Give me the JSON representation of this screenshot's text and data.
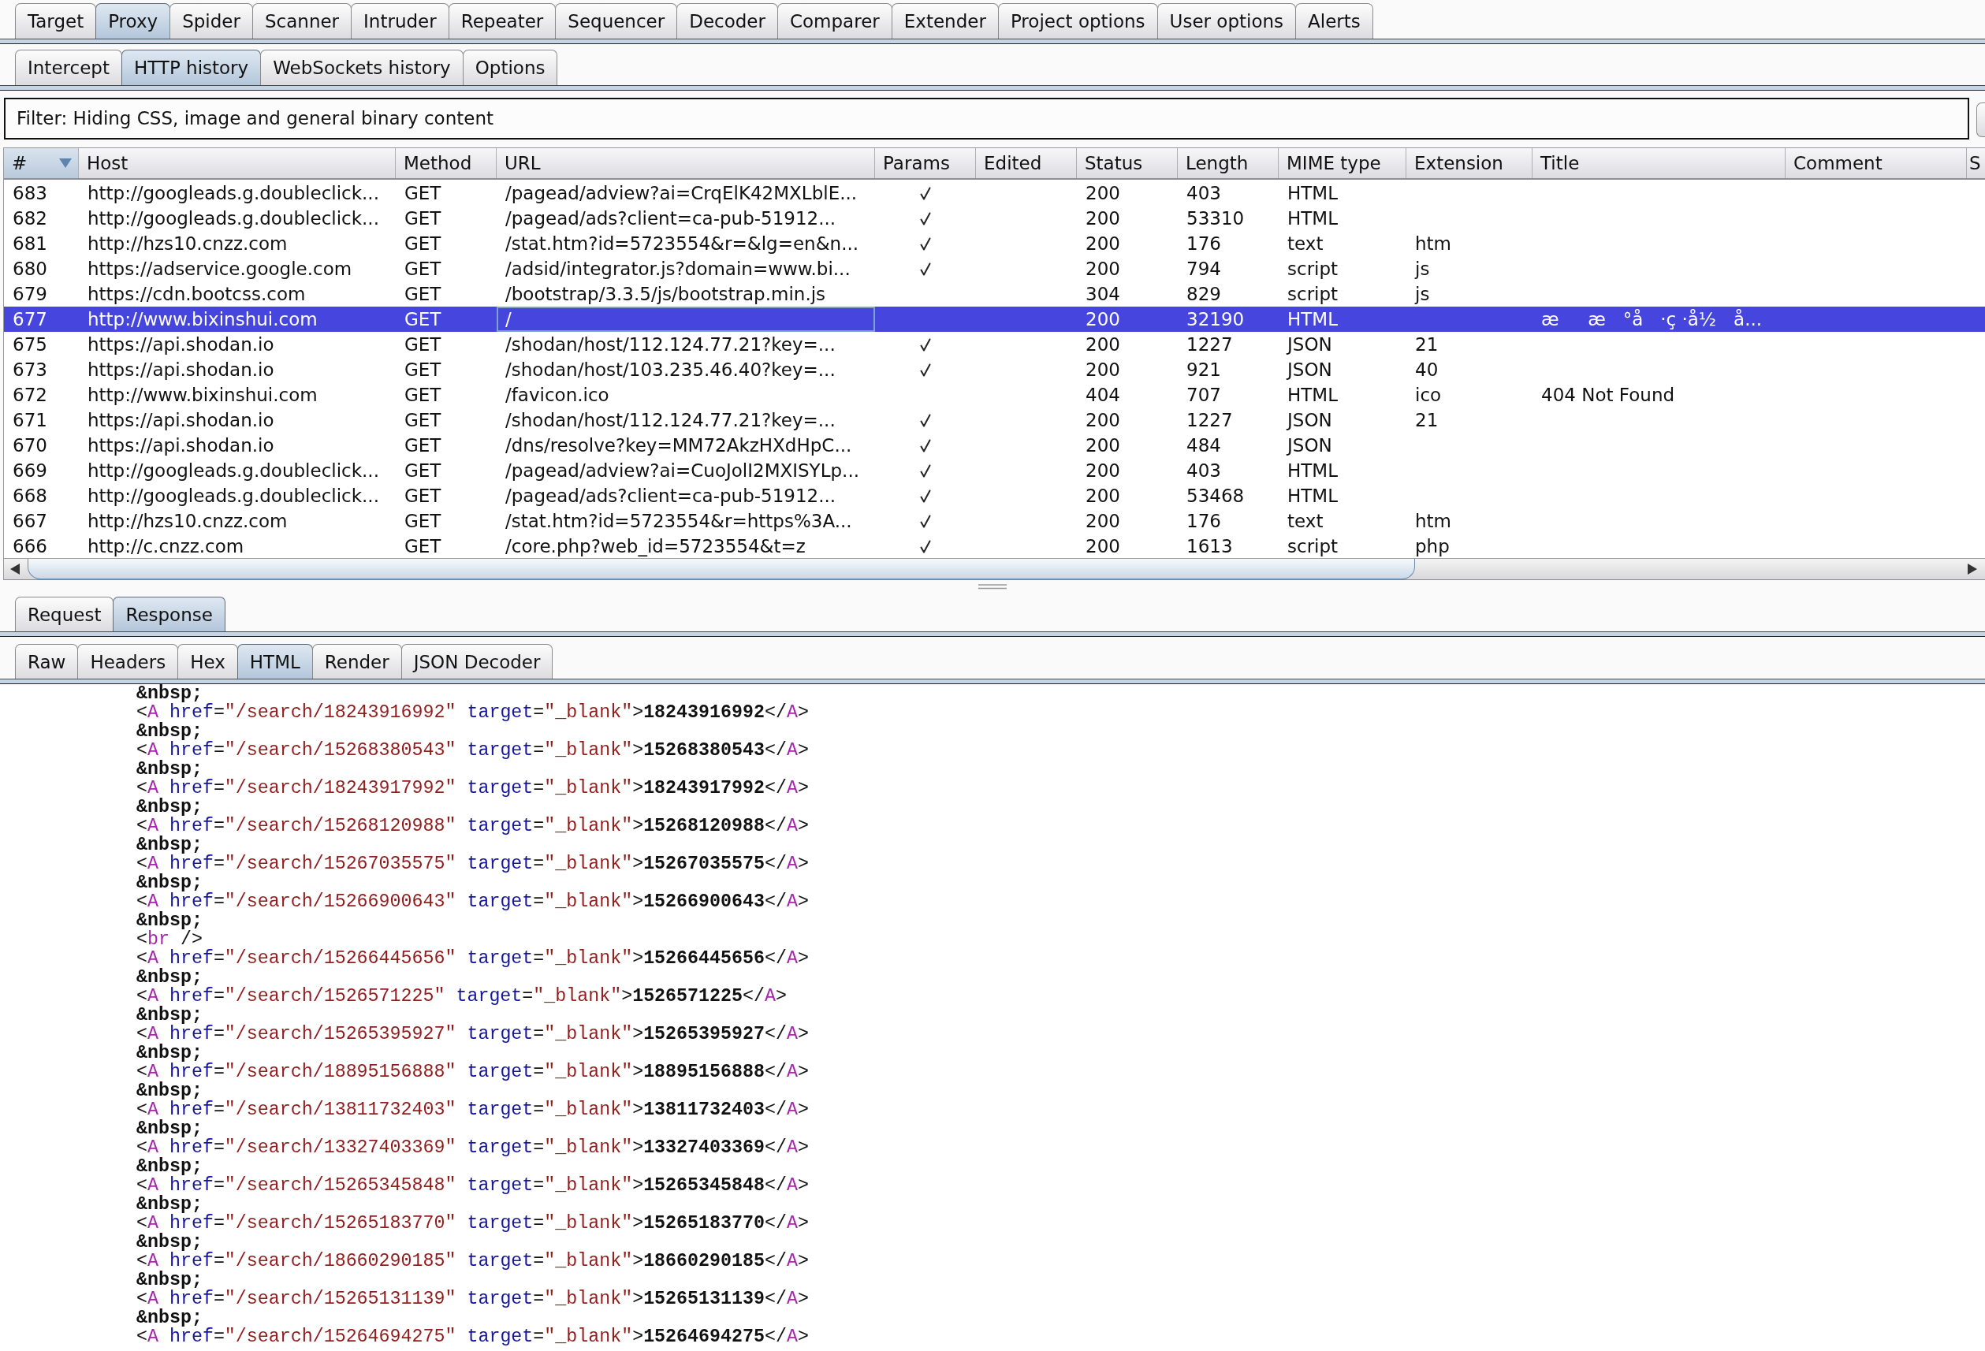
{
  "main_tabs": [
    {
      "label": "Target",
      "selected": false
    },
    {
      "label": "Proxy",
      "selected": true
    },
    {
      "label": "Spider",
      "selected": false
    },
    {
      "label": "Scanner",
      "selected": false
    },
    {
      "label": "Intruder",
      "selected": false
    },
    {
      "label": "Repeater",
      "selected": false
    },
    {
      "label": "Sequencer",
      "selected": false
    },
    {
      "label": "Decoder",
      "selected": false
    },
    {
      "label": "Comparer",
      "selected": false
    },
    {
      "label": "Extender",
      "selected": false
    },
    {
      "label": "Project options",
      "selected": false
    },
    {
      "label": "User options",
      "selected": false
    },
    {
      "label": "Alerts",
      "selected": false
    }
  ],
  "proxy_tabs": [
    {
      "label": "Intercept",
      "selected": false
    },
    {
      "label": "HTTP history",
      "selected": true
    },
    {
      "label": "WebSockets history",
      "selected": false
    },
    {
      "label": "Options",
      "selected": false
    }
  ],
  "filter": {
    "text": "Filter: Hiding CSS, image and general binary content"
  },
  "history_table": {
    "columns": [
      {
        "label": "#",
        "sorted": true
      },
      {
        "label": "Host",
        "sorted": false
      },
      {
        "label": "Method",
        "sorted": false
      },
      {
        "label": "URL",
        "sorted": false
      },
      {
        "label": "Params",
        "sorted": false
      },
      {
        "label": "Edited",
        "sorted": false
      },
      {
        "label": "Status",
        "sorted": false
      },
      {
        "label": "Length",
        "sorted": false
      },
      {
        "label": "MIME type",
        "sorted": false
      },
      {
        "label": "Extension",
        "sorted": false
      },
      {
        "label": "Title",
        "sorted": false
      },
      {
        "label": "Comment",
        "sorted": false
      },
      {
        "label": "S",
        "sorted": false
      }
    ],
    "rows": [
      {
        "number": "683",
        "host": "http://googleads.g.doubleclick...",
        "method": "GET",
        "url": "/pagead/adview?ai=CrqElK42MXLblE...",
        "params": true,
        "status": "200",
        "length": "403",
        "mime_type": "HTML",
        "selected": false
      },
      {
        "number": "682",
        "host": "http://googleads.g.doubleclick...",
        "method": "GET",
        "url": "/pagead/ads?client=ca-pub-51912...",
        "params": true,
        "status": "200",
        "length": "53310",
        "mime_type": "HTML",
        "selected": false
      },
      {
        "number": "681",
        "host": "http://hzs10.cnzz.com",
        "method": "GET",
        "url": "/stat.htm?id=5723554&r=&lg=en&n...",
        "params": true,
        "status": "200",
        "length": "176",
        "mime_type": "text",
        "extension": "htm",
        "selected": false
      },
      {
        "number": "680",
        "host": "https://adservice.google.com",
        "method": "GET",
        "url": "/adsid/integrator.js?domain=www.bi...",
        "params": true,
        "status": "200",
        "length": "794",
        "mime_type": "script",
        "extension": "js",
        "selected": false
      },
      {
        "number": "679",
        "host": "https://cdn.bootcss.com",
        "method": "GET",
        "url": "/bootstrap/3.3.5/js/bootstrap.min.js",
        "params": false,
        "status": "304",
        "length": "829",
        "mime_type": "script",
        "extension": "js",
        "selected": false
      },
      {
        "number": "677",
        "host": "http://www.bixinshui.com",
        "method": "GET",
        "url": "/",
        "params": false,
        "status": "200",
        "length": "32190",
        "mime_type": "HTML",
        "title": "æ     æ   °å   ·ç ·å½   å...",
        "selected": true
      },
      {
        "number": "675",
        "host": "https://api.shodan.io",
        "method": "GET",
        "url": "/shodan/host/112.124.77.21?key=...",
        "params": true,
        "status": "200",
        "length": "1227",
        "mime_type": "JSON",
        "extension": "21",
        "selected": false
      },
      {
        "number": "673",
        "host": "https://api.shodan.io",
        "method": "GET",
        "url": "/shodan/host/103.235.46.40?key=...",
        "params": true,
        "status": "200",
        "length": "921",
        "mime_type": "JSON",
        "extension": "40",
        "selected": false
      },
      {
        "number": "672",
        "host": "http://www.bixinshui.com",
        "method": "GET",
        "url": "/favicon.ico",
        "params": false,
        "status": "404",
        "length": "707",
        "mime_type": "HTML",
        "extension": "ico",
        "title": "404 Not Found",
        "selected": false
      },
      {
        "number": "671",
        "host": "https://api.shodan.io",
        "method": "GET",
        "url": "/shodan/host/112.124.77.21?key=...",
        "params": true,
        "status": "200",
        "length": "1227",
        "mime_type": "JSON",
        "extension": "21",
        "selected": false
      },
      {
        "number": "670",
        "host": "https://api.shodan.io",
        "method": "GET",
        "url": "/dns/resolve?key=MM72AkzHXdHpC...",
        "params": true,
        "status": "200",
        "length": "484",
        "mime_type": "JSON",
        "selected": false
      },
      {
        "number": "669",
        "host": "http://googleads.g.doubleclick...",
        "method": "GET",
        "url": "/pagead/adview?ai=CuoJolI2MXISYLp...",
        "params": true,
        "status": "200",
        "length": "403",
        "mime_type": "HTML",
        "selected": false
      },
      {
        "number": "668",
        "host": "http://googleads.g.doubleclick...",
        "method": "GET",
        "url": "/pagead/ads?client=ca-pub-51912...",
        "params": true,
        "status": "200",
        "length": "53468",
        "mime_type": "HTML",
        "selected": false
      },
      {
        "number": "667",
        "host": "http://hzs10.cnzz.com",
        "method": "GET",
        "url": "/stat.htm?id=5723554&r=https%3A...",
        "params": true,
        "status": "200",
        "length": "176",
        "mime_type": "text",
        "extension": "htm",
        "selected": false
      },
      {
        "number": "666",
        "host": "http://c.cnzz.com",
        "method": "GET",
        "url": "/core.php?web_id=5723554&t=z",
        "params": true,
        "status": "200",
        "length": "1613",
        "mime_type": "script",
        "extension": "php",
        "selected": false
      }
    ]
  },
  "message_tabs": [
    {
      "label": "Request",
      "selected": false
    },
    {
      "label": "Response",
      "selected": true
    }
  ],
  "view_tabs": [
    {
      "label": "Raw",
      "selected": false
    },
    {
      "label": "Headers",
      "selected": false
    },
    {
      "label": "Hex",
      "selected": false
    },
    {
      "label": "HTML",
      "selected": true
    },
    {
      "label": "Render",
      "selected": false
    },
    {
      "label": "JSON Decoder",
      "selected": false
    }
  ],
  "html_view": {
    "lines": [
      "&nbsp;",
      "<A href=\"/search/18243916992\" target=\"_blank\">18243916992</A>",
      "&nbsp;",
      "<A href=\"/search/15268380543\" target=\"_blank\">15268380543</A>",
      "&nbsp;",
      "<A href=\"/search/18243917992\" target=\"_blank\">18243917992</A>",
      "&nbsp;",
      "<A href=\"/search/15268120988\" target=\"_blank\">15268120988</A>",
      "&nbsp;",
      "<A href=\"/search/15267035575\" target=\"_blank\">15267035575</A>",
      "&nbsp;",
      "<A href=\"/search/15266900643\" target=\"_blank\">15266900643</A>",
      "&nbsp;",
      "<br />",
      "<A href=\"/search/15266445656\" target=\"_blank\">15266445656</A>",
      "&nbsp;",
      "<A href=\"/search/1526571225\" target=\"_blank\">1526571225</A>",
      "&nbsp;",
      "<A href=\"/search/15265395927\" target=\"_blank\">15265395927</A>",
      "&nbsp;",
      "<A href=\"/search/18895156888\" target=\"_blank\">18895156888</A>",
      "&nbsp;",
      "<A href=\"/search/13811732403\" target=\"_blank\">13811732403</A>",
      "&nbsp;",
      "<A href=\"/search/13327403369\" target=\"_blank\">13327403369</A>",
      "&nbsp;",
      "<A href=\"/search/15265345848\" target=\"_blank\">15265345848</A>",
      "&nbsp;",
      "<A href=\"/search/15265183770\" target=\"_blank\">15265183770</A>",
      "&nbsp;",
      "<A href=\"/search/18660290185\" target=\"_blank\">18660290185</A>",
      "&nbsp;",
      "<A href=\"/search/15265131139\" target=\"_blank\">15265131139</A>",
      "&nbsp;",
      "<A href=\"/search/15264694275\" target=\"_blank\">15264694275</A>"
    ]
  }
}
